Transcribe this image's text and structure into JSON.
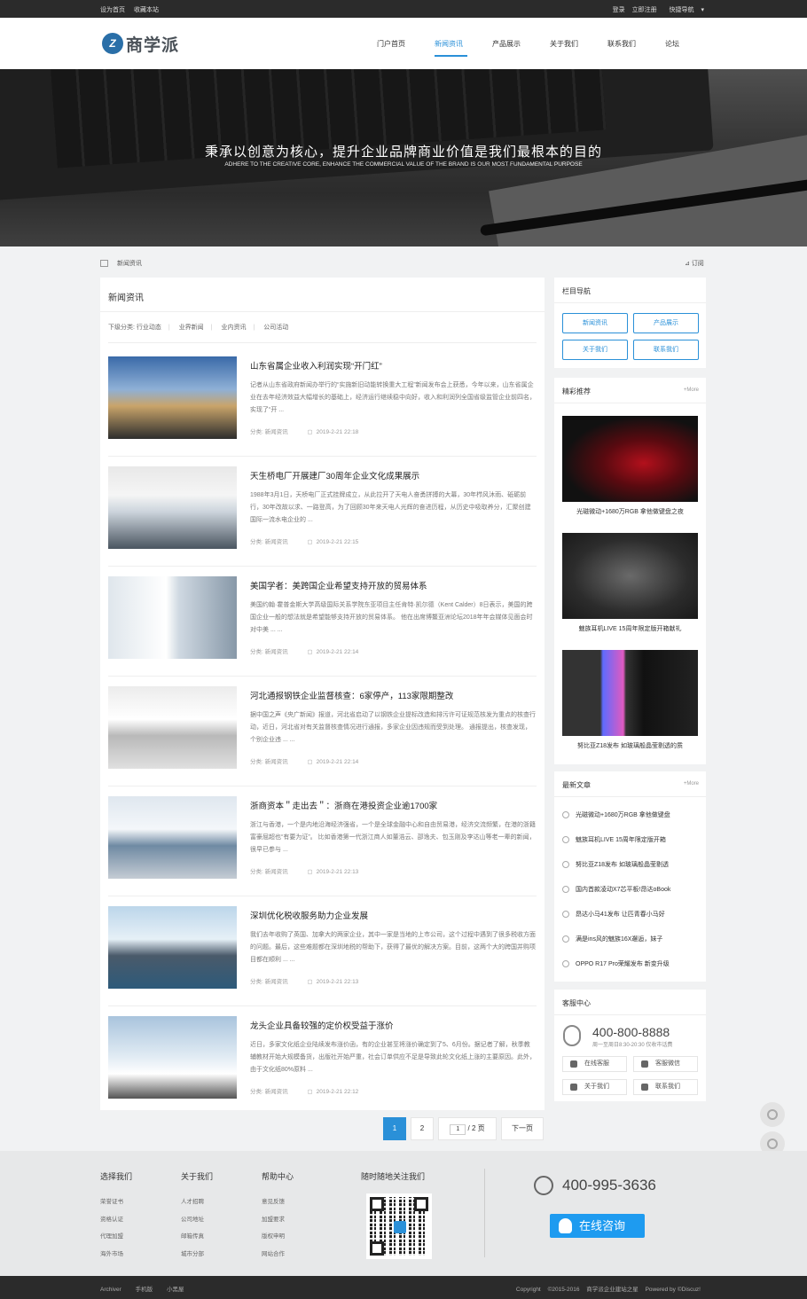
{
  "topbar": {
    "set_home": "设为首页",
    "bookmark": "收藏本站",
    "login": "登录",
    "register": "立即注册",
    "quick_nav": "快捷导航"
  },
  "logo": {
    "mark": "Z",
    "text": "商学派"
  },
  "nav": [
    {
      "label": "门户首页"
    },
    {
      "label": "新闻资讯",
      "active": true
    },
    {
      "label": "产品展示"
    },
    {
      "label": "关于我们"
    },
    {
      "label": "联系我们"
    },
    {
      "label": "论坛"
    }
  ],
  "banner": {
    "title_cn": "秉承以创意为核心，提升企业品牌商业价值是我们最根本的目的",
    "title_en": "ADHERE TO THE CREATIVE CORE, ENHANCE THE COMMERCIAL VALUE OF THE BRAND IS OUR MOST FUNDAMENTAL PURPOSE"
  },
  "breadcrumb": {
    "current": "新闻资讯",
    "rss": "订阅"
  },
  "main": {
    "title": "新闻资讯",
    "subcat_label": "下级分类:",
    "subcats": [
      "行业动态",
      "业界新闻",
      "业内资讯",
      "公司活动"
    ],
    "articles": [
      {
        "title": "山东省属企业收入利润实现“开门红”",
        "desc": "记者从山东省政府新闻办举行的“实施新旧动能转换重大工程”新闻发布会上获悉，今年以来，山东省属企业在去年经济效益大幅增长的基础上，经济运行继续稳中向好，收入和利润列全国省级监管企业前四名，实现了“开 ...",
        "category": "分类: 新闻资讯",
        "date": "2019-2-21 22:18",
        "img": "city"
      },
      {
        "title": "天生桥电厂开展建厂30周年企业文化成果展示",
        "desc": "1988年3月1日，天桥电厂正式挂牌成立，从此拉开了天电人奋勇拼搏的大幕，30年栉风沐雨、砥砺前行，30年改故以求、一路登高，为了回顾30年来天电人光辉的奋进历程，从历史中吸取养分，汇聚创建国际一流水电企业的 ...",
        "category": "分类: 新闻资讯",
        "date": "2019-2-21 22:15",
        "img": "meeting"
      },
      {
        "title": "美国学者：美跨国企业希望支持开放的贸易体系",
        "desc": "美国约翰·霍普金斯大学高级国际关系学院东亚项目主任肯特·凯尔德（Kent Calder）8日表示，美国的跨国企业一般的想法就是希望能够支持开放的贸易体系。    他在出席博鳌亚洲论坛2018年年会媒体见面会时对中美 ... ...",
        "category": "分类: 新闻资讯",
        "date": "2019-2-21 22:14",
        "img": "corridor"
      },
      {
        "title": "河北通报钢铁企业监督核查：6家停产，113家限期整改",
        "desc": "据中国之声《央广新闻》报道，河北省启动了以钢铁企业提标改造和排污许可证规范核发为重点的核查行动，近日，河北省对有关监督核查情况进行通报，多家企业因违规而受到处理。    通报提出，核查发现，个别企业违 ... ...",
        "category": "分类: 新闻资讯",
        "date": "2019-2-21 22:14",
        "img": "room"
      },
      {
        "title": "浙商资本＂走出去＂：浙商在港投资企业逾1700家",
        "desc": "浙江与香港，一个是内地沿海经济强省，一个是全球金融中心和自由贸易港，经济交流频繁，在港的浙籍富豪屈超也“有要为证”。    比如香港第一代浙江商人如董浩云、邵逸夫、包玉刚及李达山等老一辈的新闻，很早已参与 ...",
        "category": "分类: 新闻资讯",
        "date": "2019-2-21 22:13",
        "img": "tower"
      },
      {
        "title": "深圳优化税收服务助力企业发展",
        "desc": "我们去年收购了英国、加拿大的两家企业，其中一家是当地的上市公司，这个过程中遇到了很多税收方面的问题。最后，这些难题都在深圳地税的帮助下，获得了最优的解决方案。目前，这两个大的跨国并购项目都在顺利 ... ...",
        "category": "分类: 新闻资讯",
        "date": "2019-2-21 22:13",
        "img": "building"
      },
      {
        "title": "龙头企业具备较强的定价权受益于涨价",
        "desc": "近日，多家文化纸企业陆续发布涨价函，有的企业甚至将涨价确定到了5、6月份。据记者了解，秋季教辅教材开始大规模备货，出版社开始严重，社会订单供应不足是导致此轮文化纸上涨的主要原因。此外，由于文化纸80%原料 ...",
        "category": "分类: 新闻资讯",
        "date": "2019-2-21 22:12",
        "img": "map"
      }
    ]
  },
  "pager": {
    "pages": [
      "1",
      "2"
    ],
    "current": "1",
    "jump_value": "1",
    "total": "/ 2 页",
    "next": "下一页"
  },
  "sidebar": {
    "catnav": {
      "title": "栏目导航",
      "buttons": [
        "新闻资讯",
        "产品展示",
        "关于我们",
        "联系我们"
      ]
    },
    "recommend": {
      "title": "精彩推荐",
      "more": "+More",
      "items": [
        {
          "caption": "光磁微动+1680万RGB 拿他做键盘之夜",
          "img": "red"
        },
        {
          "caption": "魅族耳机LIVE 15周年限定版开箱献礼",
          "img": "earphone"
        },
        {
          "caption": "努比亚Z18发布 如玻璃般晶莹剔透的质",
          "img": "phone"
        }
      ]
    },
    "latest": {
      "title": "最新文章",
      "more": "+More",
      "items": [
        "光磁微动+1680万RGB 拿他做键盘",
        "魅族耳机LIVE 15周年限定版开箱",
        "努比亚Z18发布 如玻璃般晶莹剔透",
        "国内首款凌动X7芯平板!昂达oBook",
        "昂达小马41发布 让匹青春小马好",
        "满是ins风的魅族16X邂逅，妹子",
        "OPPO R17 Pro荣耀发布 新变升级"
      ]
    },
    "service": {
      "title": "客服中心",
      "phone": "400-800-8888",
      "hours": "周一至周日8:30-20:30 仅收市话费",
      "buttons": [
        "在线客服",
        "客服微信",
        "关于我们",
        "联系我们"
      ]
    }
  },
  "footer": {
    "cols": [
      {
        "title": "选择我们",
        "links": [
          "荣誉证书",
          "资格认证",
          "代理加盟",
          "海外市场"
        ]
      },
      {
        "title": "关于我们",
        "links": [
          "人才招聘",
          "公司地址",
          "邮箱传真",
          "城市分部"
        ]
      },
      {
        "title": "帮助中心",
        "links": [
          "意见反馈",
          "加盟要求",
          "版权申明",
          "网站合作"
        ]
      }
    ],
    "follow_title": "随时随地关注我们",
    "phone": "400-995-3636",
    "consult": "在线咨询"
  },
  "bottombar": {
    "links": [
      "Archiver",
      "手机版",
      "小黑屋"
    ],
    "copyright": "Copyright",
    "years": "©2015-2016",
    "site": "商学派企业建站之星",
    "powered": "Powered by",
    "brand": "©Discuz!"
  }
}
